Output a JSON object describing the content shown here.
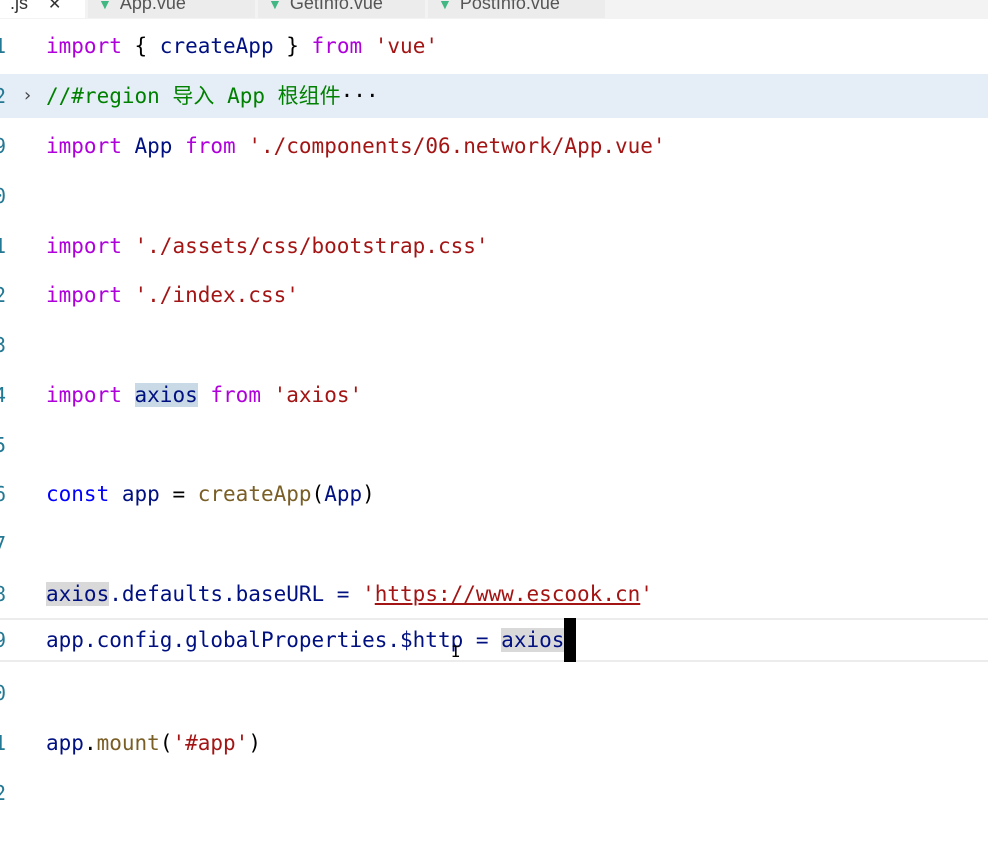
{
  "tabs": [
    {
      "label": ".js",
      "close": "✕"
    },
    {
      "label": "App.vue",
      "icon": "vue-icon"
    },
    {
      "label": "GetInfo.vue",
      "icon": "vue-icon"
    },
    {
      "label": "PostInfo.vue",
      "icon": "vue-icon"
    }
  ],
  "lines": [
    {
      "num": "1",
      "t": [
        [
          "import",
          "ctl"
        ],
        [
          " { ",
          "plain"
        ],
        [
          "createApp",
          "var"
        ],
        [
          " } ",
          "plain"
        ],
        [
          "from",
          "ctl"
        ],
        [
          " ",
          "plain"
        ],
        [
          "'vue'",
          "str"
        ]
      ]
    },
    {
      "num": "2",
      "fold": true,
      "t": [
        [
          "//#region 导入 App 根组件",
          "cm"
        ],
        [
          "···",
          "plain"
        ]
      ]
    },
    {
      "num": "9",
      "t": [
        [
          "import",
          "ctl"
        ],
        [
          " ",
          "plain"
        ],
        [
          "App",
          "var"
        ],
        [
          " ",
          "plain"
        ],
        [
          "from",
          "ctl"
        ],
        [
          " ",
          "plain"
        ],
        [
          "'./components/06.network/App.vue'",
          "str"
        ]
      ]
    },
    {
      "num": "0",
      "t": []
    },
    {
      "num": "1",
      "t": [
        [
          "import",
          "ctl"
        ],
        [
          " ",
          "plain"
        ],
        [
          "'./assets/css/bootstrap.css'",
          "str"
        ]
      ]
    },
    {
      "num": "2",
      "t": [
        [
          "import",
          "ctl"
        ],
        [
          " ",
          "plain"
        ],
        [
          "'./index.css'",
          "str"
        ]
      ]
    },
    {
      "num": "3",
      "t": []
    },
    {
      "num": "4",
      "t": [
        [
          "import",
          "ctl"
        ],
        [
          " ",
          "plain"
        ],
        [
          "axios",
          "var hl"
        ],
        [
          " ",
          "plain"
        ],
        [
          "from",
          "ctl"
        ],
        [
          " ",
          "plain"
        ],
        [
          "'axios'",
          "str"
        ]
      ]
    },
    {
      "num": "5",
      "t": []
    },
    {
      "num": "6",
      "t": [
        [
          "const",
          "kw2"
        ],
        [
          " ",
          "plain"
        ],
        [
          "app",
          "var"
        ],
        [
          " = ",
          "plain"
        ],
        [
          "createApp",
          "fn"
        ],
        [
          "(",
          "plain"
        ],
        [
          "App",
          "var"
        ],
        [
          ")",
          "plain"
        ]
      ]
    },
    {
      "num": "7",
      "t": []
    },
    {
      "num": "8",
      "t": [
        [
          "axios",
          "var hl2"
        ],
        [
          ".defaults.baseURL = ",
          "var"
        ],
        [
          "'",
          "str"
        ],
        [
          "https://www.escook.cn",
          "str link"
        ],
        [
          "'",
          "str"
        ]
      ]
    },
    {
      "num": "9",
      "current": true,
      "t": [
        [
          "app",
          "var"
        ],
        [
          ".config.globalProperties.$http = ",
          "var"
        ],
        [
          "axios",
          "var hl2"
        ]
      ]
    },
    {
      "num": "0",
      "t": []
    },
    {
      "num": "1",
      "t": [
        [
          "app",
          "var"
        ],
        [
          ".",
          "plain"
        ],
        [
          "mount",
          "fn"
        ],
        [
          "(",
          "plain"
        ],
        [
          "'#app'",
          "str"
        ],
        [
          ")",
          "plain"
        ]
      ]
    },
    {
      "num": "2",
      "t": []
    }
  ]
}
